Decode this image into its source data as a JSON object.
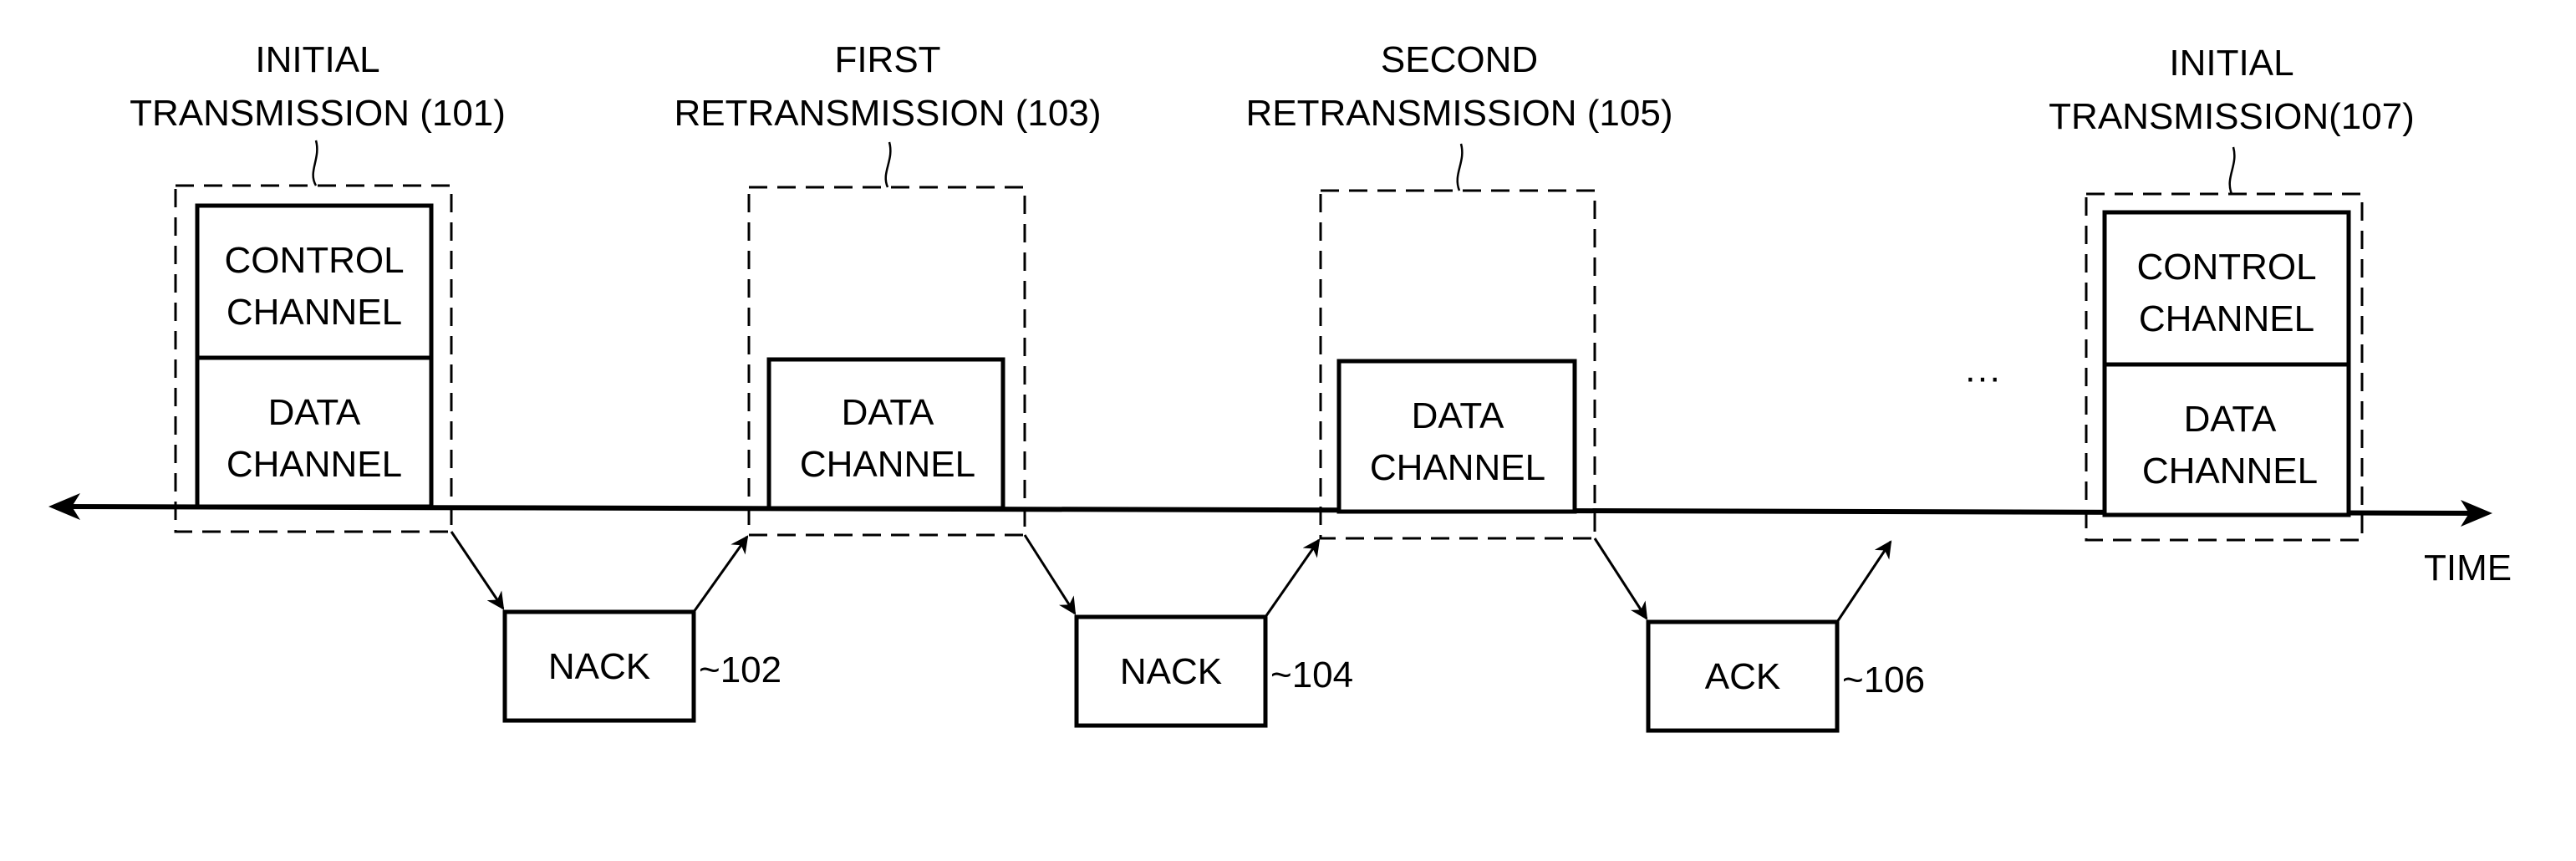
{
  "diagram": {
    "axis_label": "TIME",
    "ellipsis": "···",
    "transmissions": [
      {
        "id": "101",
        "title_line1": "INITIAL",
        "title_line2": "TRANSMISSION (101)",
        "channels": [
          {
            "line1": "CONTROL",
            "line2": "CHANNEL"
          },
          {
            "line1": "DATA",
            "line2": "CHANNEL"
          }
        ]
      },
      {
        "id": "103",
        "title_line1": "FIRST",
        "title_line2": "RETRANSMISSION (103)",
        "channels": [
          {
            "line1": "DATA",
            "line2": "CHANNEL"
          }
        ]
      },
      {
        "id": "105",
        "title_line1": "SECOND",
        "title_line2": "RETRANSMISSION (105)",
        "channels": [
          {
            "line1": "DATA",
            "line2": "CHANNEL"
          }
        ]
      },
      {
        "id": "107",
        "title_line1": "INITIAL",
        "title_line2": "TRANSMISSION(107)",
        "channels": [
          {
            "line1": "CONTROL",
            "line2": "CHANNEL"
          },
          {
            "line1": "DATA",
            "line2": "CHANNEL"
          }
        ]
      }
    ],
    "feedback": [
      {
        "label": "NACK",
        "ref": "~102"
      },
      {
        "label": "NACK",
        "ref": "~104"
      },
      {
        "label": "ACK",
        "ref": "~106"
      }
    ]
  }
}
